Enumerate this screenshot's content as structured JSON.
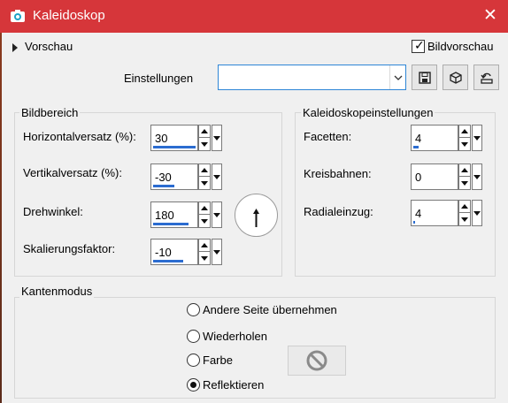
{
  "window": {
    "title": "Kaleidoskop",
    "close_glyph": "✕",
    "accent_color": "#d6363a"
  },
  "preview": {
    "toggle_label": "Vorschau",
    "bildvorschau_label": "Bildvorschau",
    "bildvorschau_checked": true
  },
  "settings": {
    "label": "Einstellungen",
    "value": ""
  },
  "bildbereich": {
    "title": "Bildbereich",
    "horizontal": {
      "label": "Horizontalversatz (%):",
      "value": "30"
    },
    "vertical": {
      "label": "Vertikalversatz (%):",
      "value": "-30"
    },
    "rotation": {
      "label": "Drehwinkel:",
      "value": "180"
    },
    "scale": {
      "label": "Skalierungsfaktor:",
      "value": "-10"
    }
  },
  "kaleido": {
    "title": "Kaleidoskopeinstellungen",
    "facets": {
      "label": "Facetten:",
      "value": "4"
    },
    "orbits": {
      "label": "Kreisbahnen:",
      "value": "0"
    },
    "radial": {
      "label": "Radialeinzug:",
      "value": "4"
    }
  },
  "edge": {
    "title": "Kantenmodus",
    "options": [
      {
        "label": "Andere Seite übernehmen",
        "selected": false
      },
      {
        "label": "Wiederholen",
        "selected": false
      },
      {
        "label": "Farbe",
        "selected": false
      },
      {
        "label": "Reflektieren",
        "selected": true
      }
    ]
  },
  "icons": [
    "camera-icon",
    "close-icon",
    "expand-triangle-icon",
    "checkbox-check-icon",
    "dropdown-arrow-icon",
    "save-preset-icon",
    "cube-preset-icon",
    "reset-default-icon",
    "spin-up-icon",
    "spin-down-icon",
    "rotation-dial-icon",
    "no-color-icon"
  ]
}
